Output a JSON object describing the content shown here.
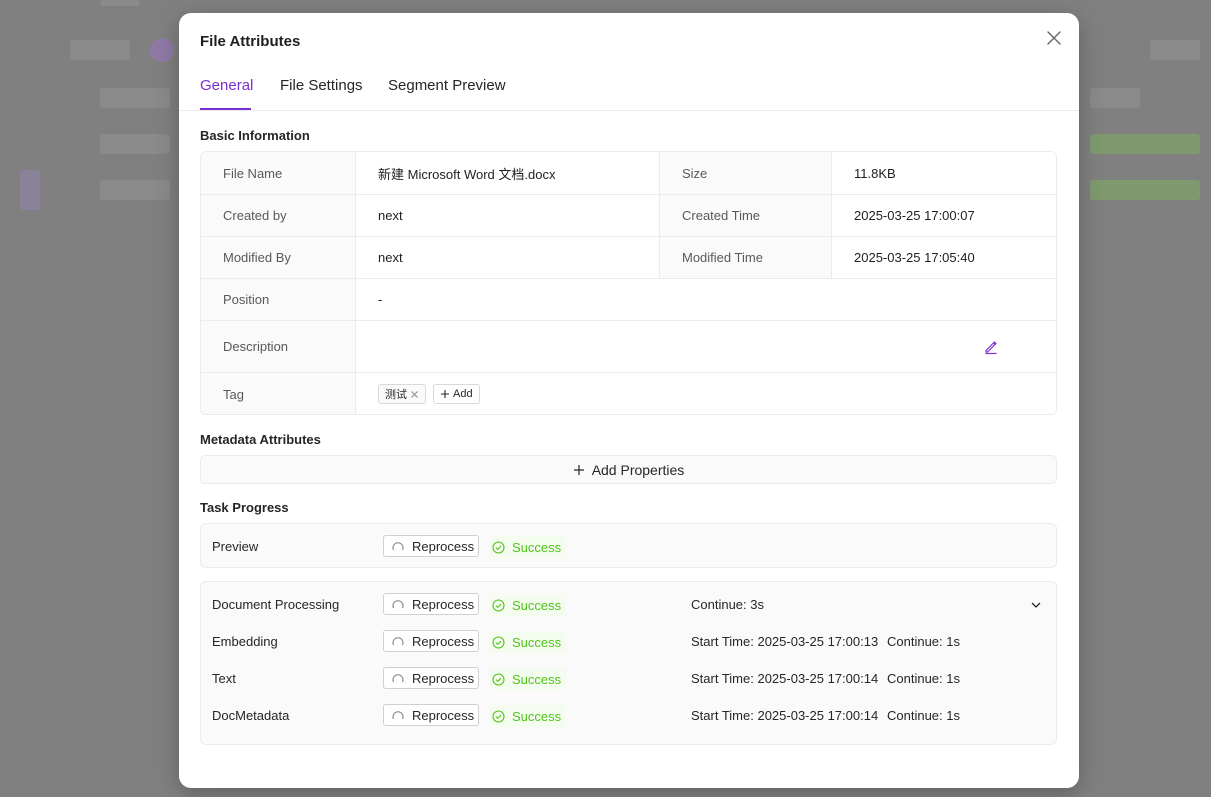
{
  "modal": {
    "title": "File Attributes"
  },
  "tabs": [
    {
      "label": "General",
      "active": true
    },
    {
      "label": "File Settings",
      "active": false
    },
    {
      "label": "Segment Preview",
      "active": false
    }
  ],
  "basic_info": {
    "section_title": "Basic Information",
    "file_name_label": "File Name",
    "file_name": "新建 Microsoft Word 文档.docx",
    "size_label": "Size",
    "size": "11.8KB",
    "created_by_label": "Created by",
    "created_by": "next",
    "created_time_label": "Created Time",
    "created_time": "2025-03-25 17:00:07",
    "modified_by_label": "Modified By",
    "modified_by": "next",
    "modified_time_label": "Modified Time",
    "modified_time": "2025-03-25 17:05:40",
    "position_label": "Position",
    "position": "-",
    "description_label": "Description",
    "description": "",
    "tag_label": "Tag",
    "tags": [
      "测试"
    ],
    "add_tag_label": "Add"
  },
  "metadata": {
    "section_title": "Metadata Attributes",
    "add_properties_label": "Add Properties"
  },
  "task_progress": {
    "section_title": "Task Progress",
    "reprocess_label": "Reprocess",
    "preview": {
      "name": "Preview",
      "status": "Success"
    },
    "processing": {
      "name": "Document Processing",
      "status": "Success",
      "continue": "Continue: 3s",
      "subtasks": [
        {
          "name": "Embedding",
          "status": "Success",
          "start_time": "Start Time: 2025-03-25 17:00:13",
          "continue": "Continue: 1s"
        },
        {
          "name": "Text",
          "status": "Success",
          "start_time": "Start Time: 2025-03-25 17:00:14",
          "continue": "Continue: 1s"
        },
        {
          "name": "DocMetadata",
          "status": "Success",
          "start_time": "Start Time: 2025-03-25 17:00:14",
          "continue": "Continue: 1s"
        }
      ]
    }
  },
  "colors": {
    "accent": "#7a2fd1",
    "success": "#52c41a"
  }
}
